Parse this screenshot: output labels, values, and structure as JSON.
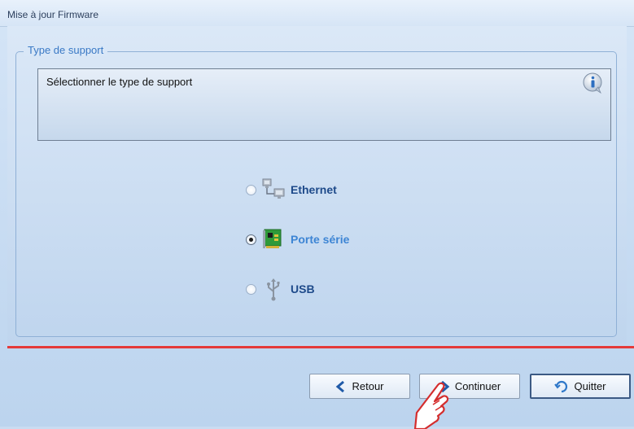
{
  "window": {
    "title": "Mise à jour Firmware"
  },
  "group": {
    "legend": "Type de support"
  },
  "info": {
    "message": "Sélectionner le type de support"
  },
  "options": [
    {
      "label": "Ethernet",
      "selected": false,
      "icon": "network-icon"
    },
    {
      "label": "Porte série",
      "selected": true,
      "icon": "serial-card-icon"
    },
    {
      "label": "USB",
      "selected": false,
      "icon": "usb-icon"
    }
  ],
  "buttons": {
    "back_label": "Retour",
    "continue_label": "Continuer",
    "quit_label": "Quitter"
  },
  "colors": {
    "separator": "#e43a3a",
    "selected_text": "#3d85d4",
    "label_text": "#1e4a8a"
  }
}
